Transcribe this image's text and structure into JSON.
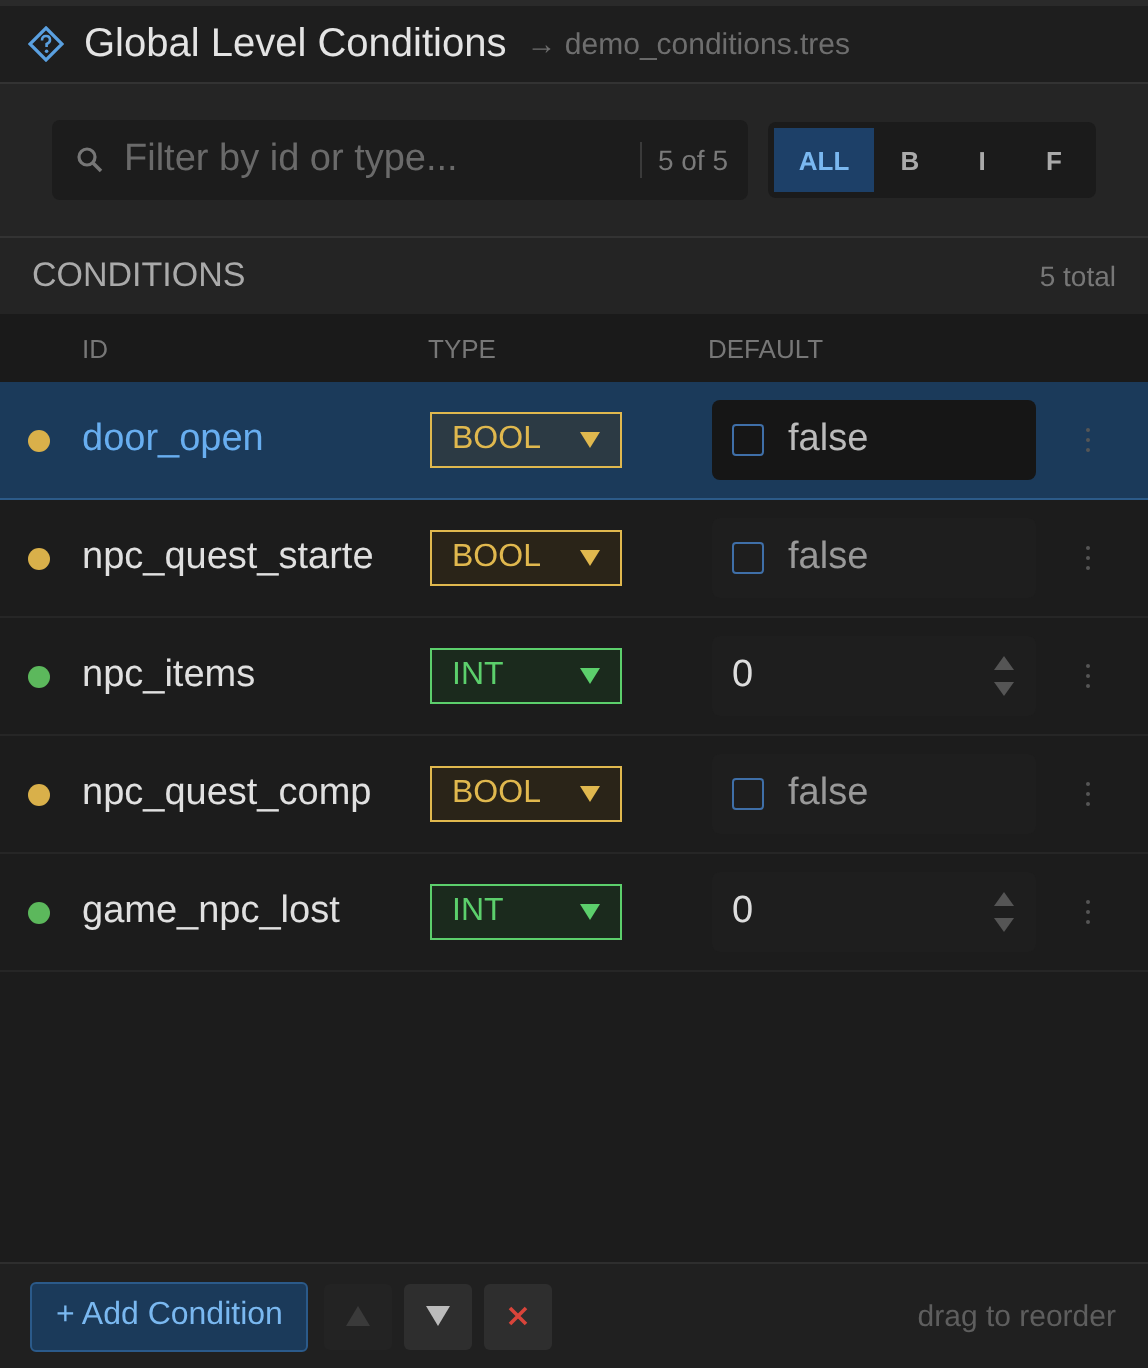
{
  "header": {
    "title": "Global Level Conditions",
    "file": "→ demo_conditions.tres"
  },
  "filter": {
    "placeholder": "Filter by id or type...",
    "count": "5 of 5",
    "chips": [
      {
        "label": "ALL",
        "selected": true
      },
      {
        "label": "B",
        "selected": false
      },
      {
        "label": "I",
        "selected": false
      },
      {
        "label": "F",
        "selected": false
      }
    ]
  },
  "section": {
    "title": "CONDITIONS",
    "total": "5 total"
  },
  "table": {
    "columns": [
      "ID",
      "TYPE",
      "DEFAULT"
    ],
    "rows": [
      {
        "id": "door_open",
        "color": "#d9b04a",
        "selected": true,
        "kind": "bool",
        "type": "BOOL",
        "checked": false,
        "value": "false"
      },
      {
        "id": "npc_quest_starte",
        "color": "#d9b04a",
        "selected": false,
        "kind": "bool",
        "type": "BOOL",
        "checked": false,
        "value": "false"
      },
      {
        "id": "npc_items",
        "color": "#5cb85c",
        "selected": false,
        "kind": "int",
        "type": "INT",
        "value": "0"
      },
      {
        "id": "npc_quest_comp",
        "color": "#d9b04a",
        "selected": false,
        "kind": "bool",
        "type": "BOOL",
        "checked": false,
        "value": "false"
      },
      {
        "id": "game_npc_lost",
        "color": "#5cb85c",
        "selected": false,
        "kind": "int",
        "type": "INT",
        "value": "0"
      }
    ]
  },
  "footer": {
    "add": "+ Add Condition",
    "move_up_disabled": true,
    "move_down_disabled": false,
    "hint": "drag to reorder"
  }
}
